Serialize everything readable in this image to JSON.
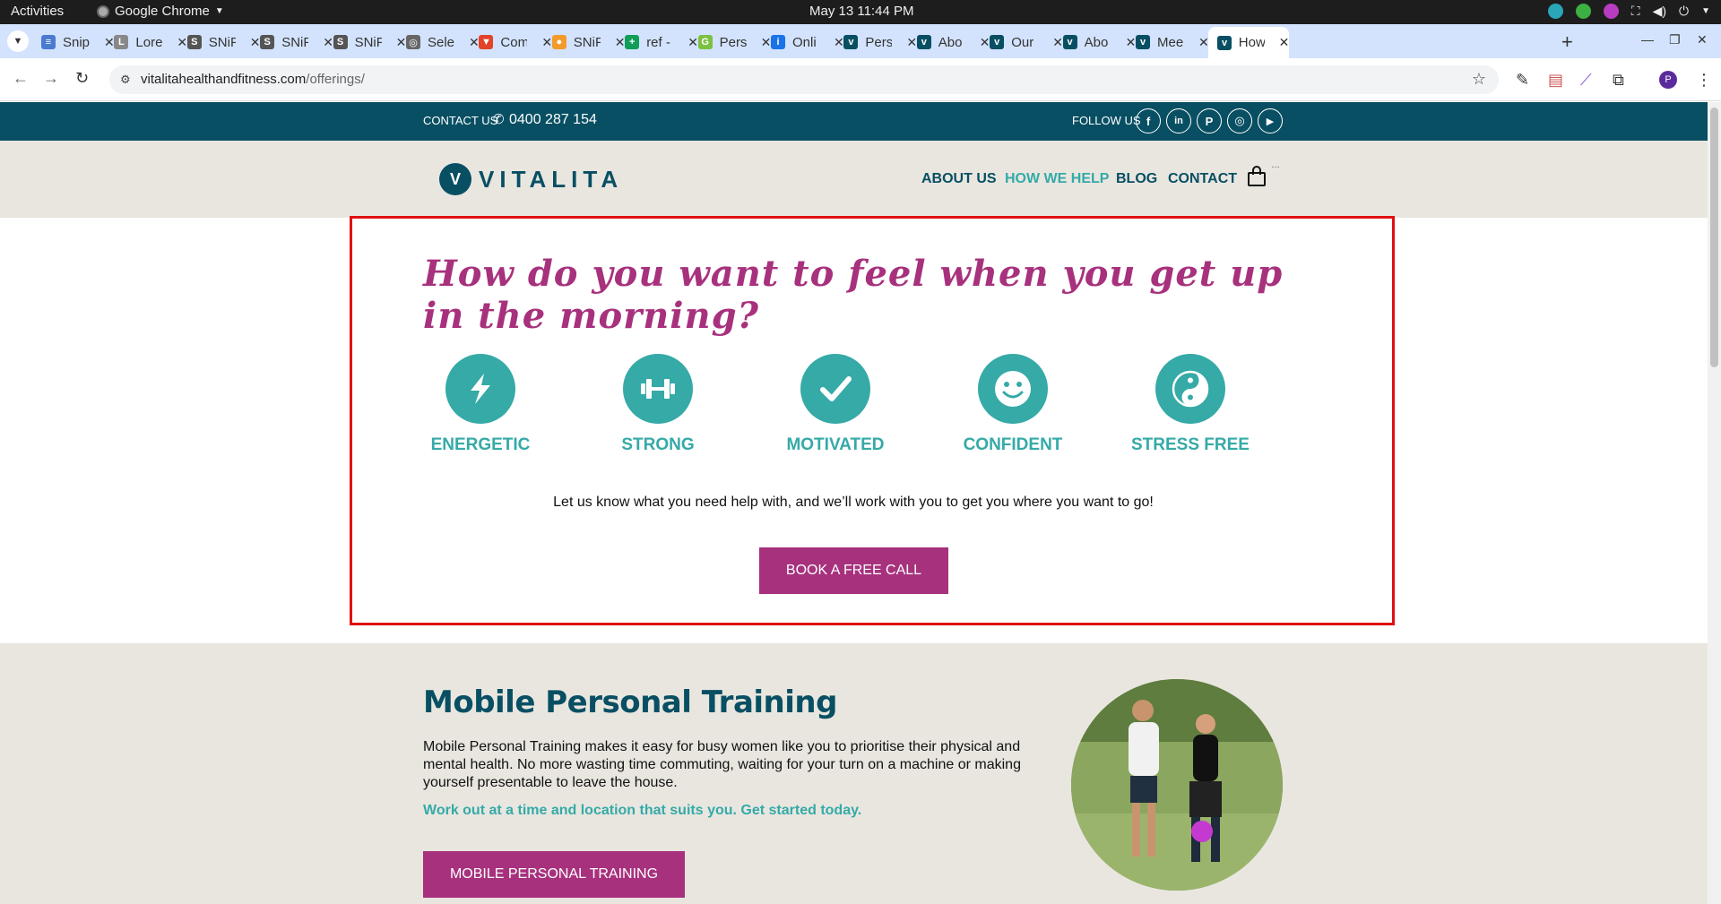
{
  "os_bar": {
    "activities": "Activities",
    "app_name": "Google Chrome",
    "clock": "May 13  11:44 PM"
  },
  "browser": {
    "tabs": [
      {
        "title": "Snip",
        "favicon_color": "#4a7bd0",
        "favicon_glyph": "≡"
      },
      {
        "title": "Lore",
        "favicon_color": "#888888",
        "favicon_glyph": "L"
      },
      {
        "title": "SNiP",
        "favicon_color": "#555555",
        "favicon_glyph": "S"
      },
      {
        "title": "SNiP",
        "favicon_color": "#555555",
        "favicon_glyph": "S"
      },
      {
        "title": "SNiP",
        "favicon_color": "#555555",
        "favicon_glyph": "S"
      },
      {
        "title": "Sele",
        "favicon_color": "#666666",
        "favicon_glyph": "◎"
      },
      {
        "title": "Com",
        "favicon_color": "#e24329",
        "favicon_glyph": "▼"
      },
      {
        "title": "SNiP",
        "favicon_color": "#f29b2c",
        "favicon_glyph": "●"
      },
      {
        "title": "ref -",
        "favicon_color": "#0f9d58",
        "favicon_glyph": "+"
      },
      {
        "title": "Pers",
        "favicon_color": "#7cc142",
        "favicon_glyph": "G"
      },
      {
        "title": "Onli",
        "favicon_color": "#1a73e8",
        "favicon_glyph": "i"
      },
      {
        "title": "Pers",
        "favicon_color": "#084f63",
        "favicon_glyph": "v"
      },
      {
        "title": "Abo",
        "favicon_color": "#084f63",
        "favicon_glyph": "v"
      },
      {
        "title": "Our",
        "favicon_color": "#084f63",
        "favicon_glyph": "v"
      },
      {
        "title": "Abo",
        "favicon_color": "#084f63",
        "favicon_glyph": "v"
      },
      {
        "title": "Mee",
        "favicon_color": "#084f63",
        "favicon_glyph": "v"
      }
    ],
    "active_tab": {
      "title": "How",
      "favicon_color": "#084f63",
      "favicon_glyph": "v"
    },
    "url_host": "vitalitahealthandfitness.com",
    "url_path": "/offerings/",
    "profile_initial": "P"
  },
  "site": {
    "contact_label": "CONTACT US",
    "phone": "0400 287 154",
    "follow_label": "FOLLOW US",
    "social": [
      "f",
      "in",
      "P",
      "◎",
      "▶"
    ],
    "logo_text": "VITALITA",
    "nav": {
      "about": "ABOUT US",
      "how_we_help": "HOW WE HELP",
      "blog": "BLOG",
      "contact": "CONTACT"
    },
    "headline": "How do you want to feel when you get up in the morning?",
    "feelings": [
      {
        "label": "ENERGETIC",
        "icon": "lightning-icon"
      },
      {
        "label": "STRONG",
        "icon": "dumbbell-icon"
      },
      {
        "label": "MOTIVATED",
        "icon": "checkmark-icon"
      },
      {
        "label": "CONFIDENT",
        "icon": "smiley-icon"
      },
      {
        "label": "STRESS FREE",
        "icon": "yin-yang-icon"
      }
    ],
    "intro": "Let us know what you need help with, and we’ll work with you to get you where you want to go!",
    "cta": "BOOK A FREE CALL",
    "section": {
      "title": "Mobile Personal Training",
      "body": "Mobile Personal Training makes it easy for busy women like you to prioritise their physical and mental health. No more wasting time commuting, waiting for your turn on a machine or making yourself presentable to leave the house.",
      "subtitle": "Work out at a time and location that suits you. Get started today.",
      "button": "MOBILE PERSONAL TRAINING"
    }
  },
  "colors": {
    "teal_dark": "#084f63",
    "teal": "#35aaa7",
    "magenta": "#a7317d",
    "beige": "#e9e6e0",
    "highlight_red": "#e01010"
  }
}
